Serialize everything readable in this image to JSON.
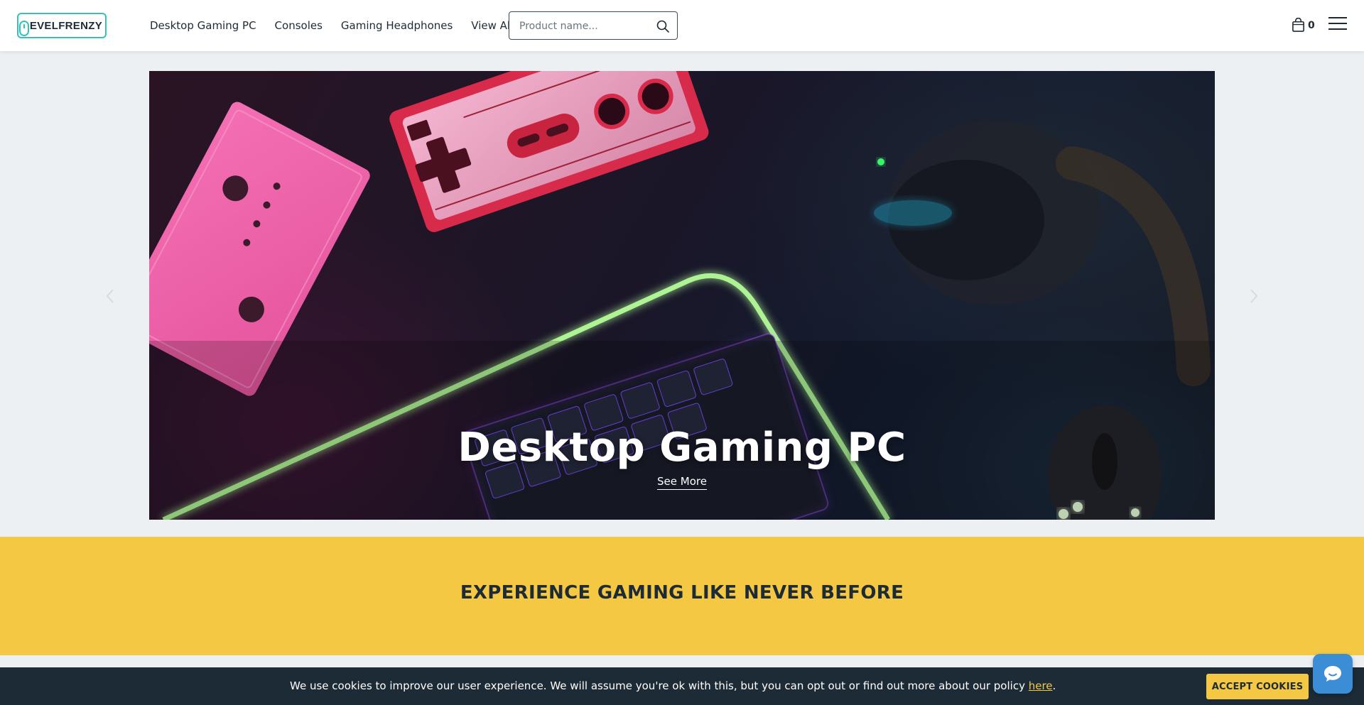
{
  "header": {
    "logo_text": "LEVELFRENZY",
    "nav": [
      {
        "label": "Desktop Gaming PC"
      },
      {
        "label": "Consoles"
      },
      {
        "label": "Gaming Headphones"
      },
      {
        "label": "View All"
      }
    ],
    "search": {
      "placeholder": "Product name...",
      "icon": "search-icon"
    },
    "cart": {
      "count": "0",
      "icon": "shopping-bag-icon"
    },
    "menu_icon": "hamburger-menu-icon"
  },
  "hero": {
    "title": "Desktop Gaming PC",
    "link": "See More",
    "prev_icon": "chevron-left-icon",
    "next_icon": "chevron-right-icon"
  },
  "banner": {
    "heading": "EXPERIENCE GAMING LIKE NEVER BEFORE"
  },
  "cookie": {
    "text": "We use cookies to improve our user experience. We will assume you're ok with this, but you can opt out or find out more about our policy ",
    "link": "here",
    "suffix": ".",
    "button": "ACCEPT COOKIES"
  },
  "chat": {
    "icon": "chat-bubble-icon"
  },
  "colors": {
    "accent_yellow": "#f5c844",
    "navy": "#1d2b36",
    "logo_teal": "#2fc4b6",
    "chat_blue": "#3b8ed6"
  }
}
